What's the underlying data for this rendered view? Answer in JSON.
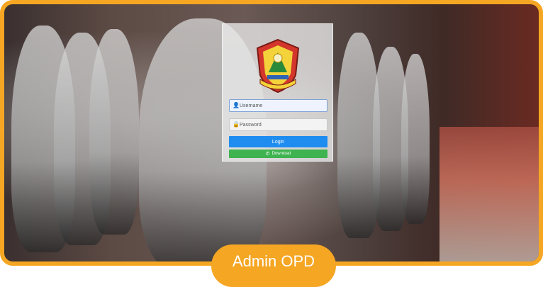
{
  "login": {
    "username_placeholder": "Username",
    "password_placeholder": "Password",
    "login_label": "Login",
    "download_label": "Download"
  },
  "footer": {
    "badge_text": "Admin OPD"
  },
  "colors": {
    "frame_border": "#f5a623",
    "login_button": "#1f8cf0",
    "download_button": "#3eb34f"
  },
  "icons": {
    "user_field": "user-icon",
    "password_field": "lock-icon",
    "download": "whatsapp-icon"
  }
}
